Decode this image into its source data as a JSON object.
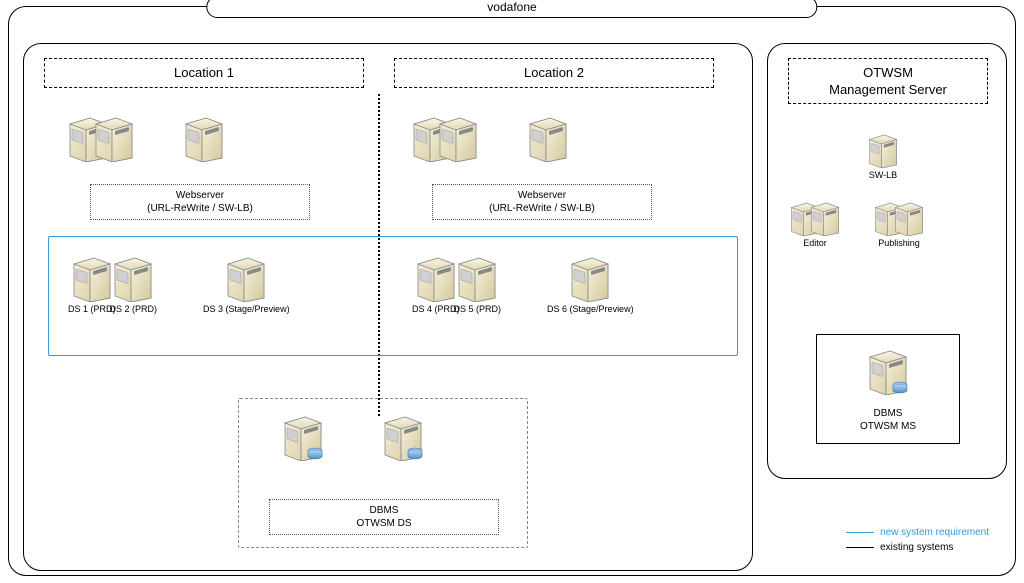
{
  "title": "vodafone",
  "locations": {
    "loc1": "Location 1",
    "loc2": "Location 2"
  },
  "webserver_label_l1": "Webserver",
  "webserver_label_l2": "(URL-ReWrite / SW-LB)",
  "ds": {
    "ds1": "DS 1 (PRD)",
    "ds2": "DS 2 (PRD)",
    "ds3": "DS 3 (Stage/Preview)",
    "ds4": "DS 4 (PRD)",
    "ds5": "DS 5 (PRD)",
    "ds6": "DS 6 (Stage/Preview)"
  },
  "dbms_ds_l1": "DBMS",
  "dbms_ds_l2": "OTWSM DS",
  "mgmt": {
    "title_l1": "OTWSM",
    "title_l2": "Management Server",
    "swlb": "SW-LB",
    "editor": "Editor",
    "publishing": "Publishing",
    "dbms_l1": "DBMS",
    "dbms_l2": "OTWSM MS"
  },
  "legend": {
    "new": "new system requirement",
    "existing": "existing systems"
  }
}
